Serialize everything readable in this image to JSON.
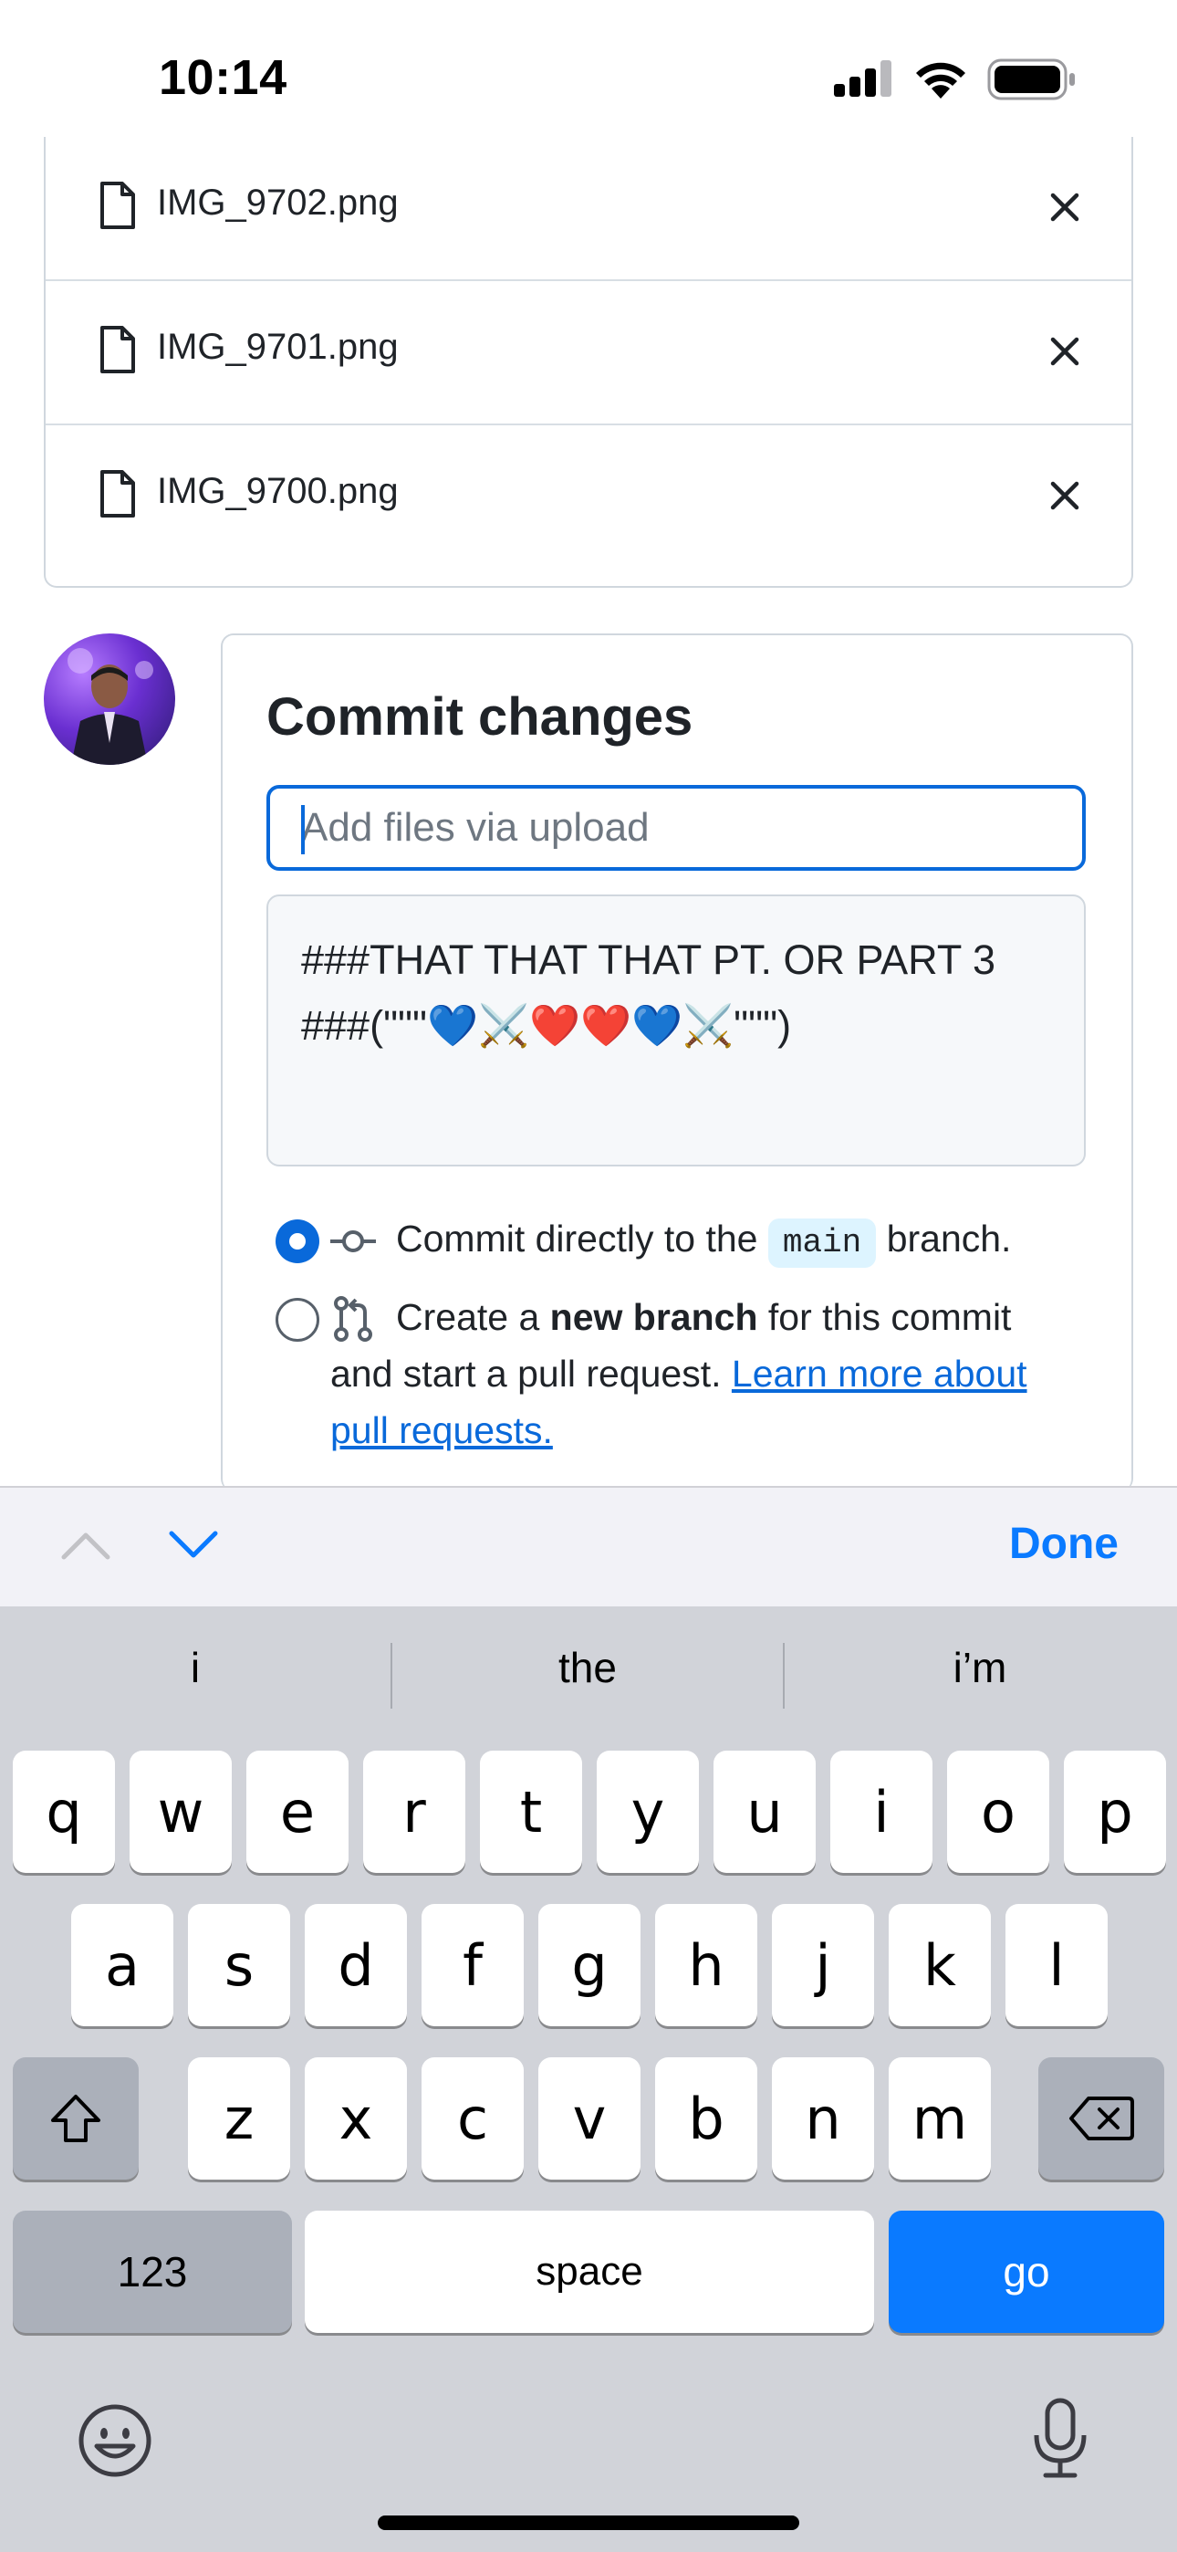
{
  "status_bar": {
    "time": "10:14"
  },
  "files": [
    {
      "name": "IMG_9702.png"
    },
    {
      "name": "IMG_9701.png"
    },
    {
      "name": "IMG_9700.png"
    }
  ],
  "commit": {
    "title": "Commit changes",
    "summary_placeholder": "Add files via upload",
    "summary_value": "",
    "description": "###THAT THAT THAT PT. OR PART 3\n###(\"\"\"💙⚔️❤️❤️💙⚔️\"\"\")",
    "option_direct": {
      "prefix": "Commit directly to the",
      "branch": "main",
      "suffix": "branch.",
      "selected": true
    },
    "option_new_branch": {
      "prefix": "Create a",
      "bold": "new branch",
      "suffix": "for this commit",
      "line2_text": "and start a pull request.",
      "link_part1": "Learn more about",
      "link_part2": "pull requests.",
      "selected": false
    }
  },
  "accessory": {
    "done": "Done"
  },
  "keyboard": {
    "suggestions": [
      "i",
      "the",
      "i’m"
    ],
    "row1": [
      "q",
      "w",
      "e",
      "r",
      "t",
      "y",
      "u",
      "i",
      "o",
      "p"
    ],
    "row2": [
      "a",
      "s",
      "d",
      "f",
      "g",
      "h",
      "j",
      "k",
      "l"
    ],
    "row3": [
      "z",
      "x",
      "c",
      "v",
      "b",
      "n",
      "m"
    ],
    "numbers_label": "123",
    "space_label": "space",
    "go_label": "go"
  },
  "colors": {
    "accent": "#0969da",
    "keyboard_blue": "#0a7aff",
    "keyboard_bg": "#d1d3d9"
  }
}
